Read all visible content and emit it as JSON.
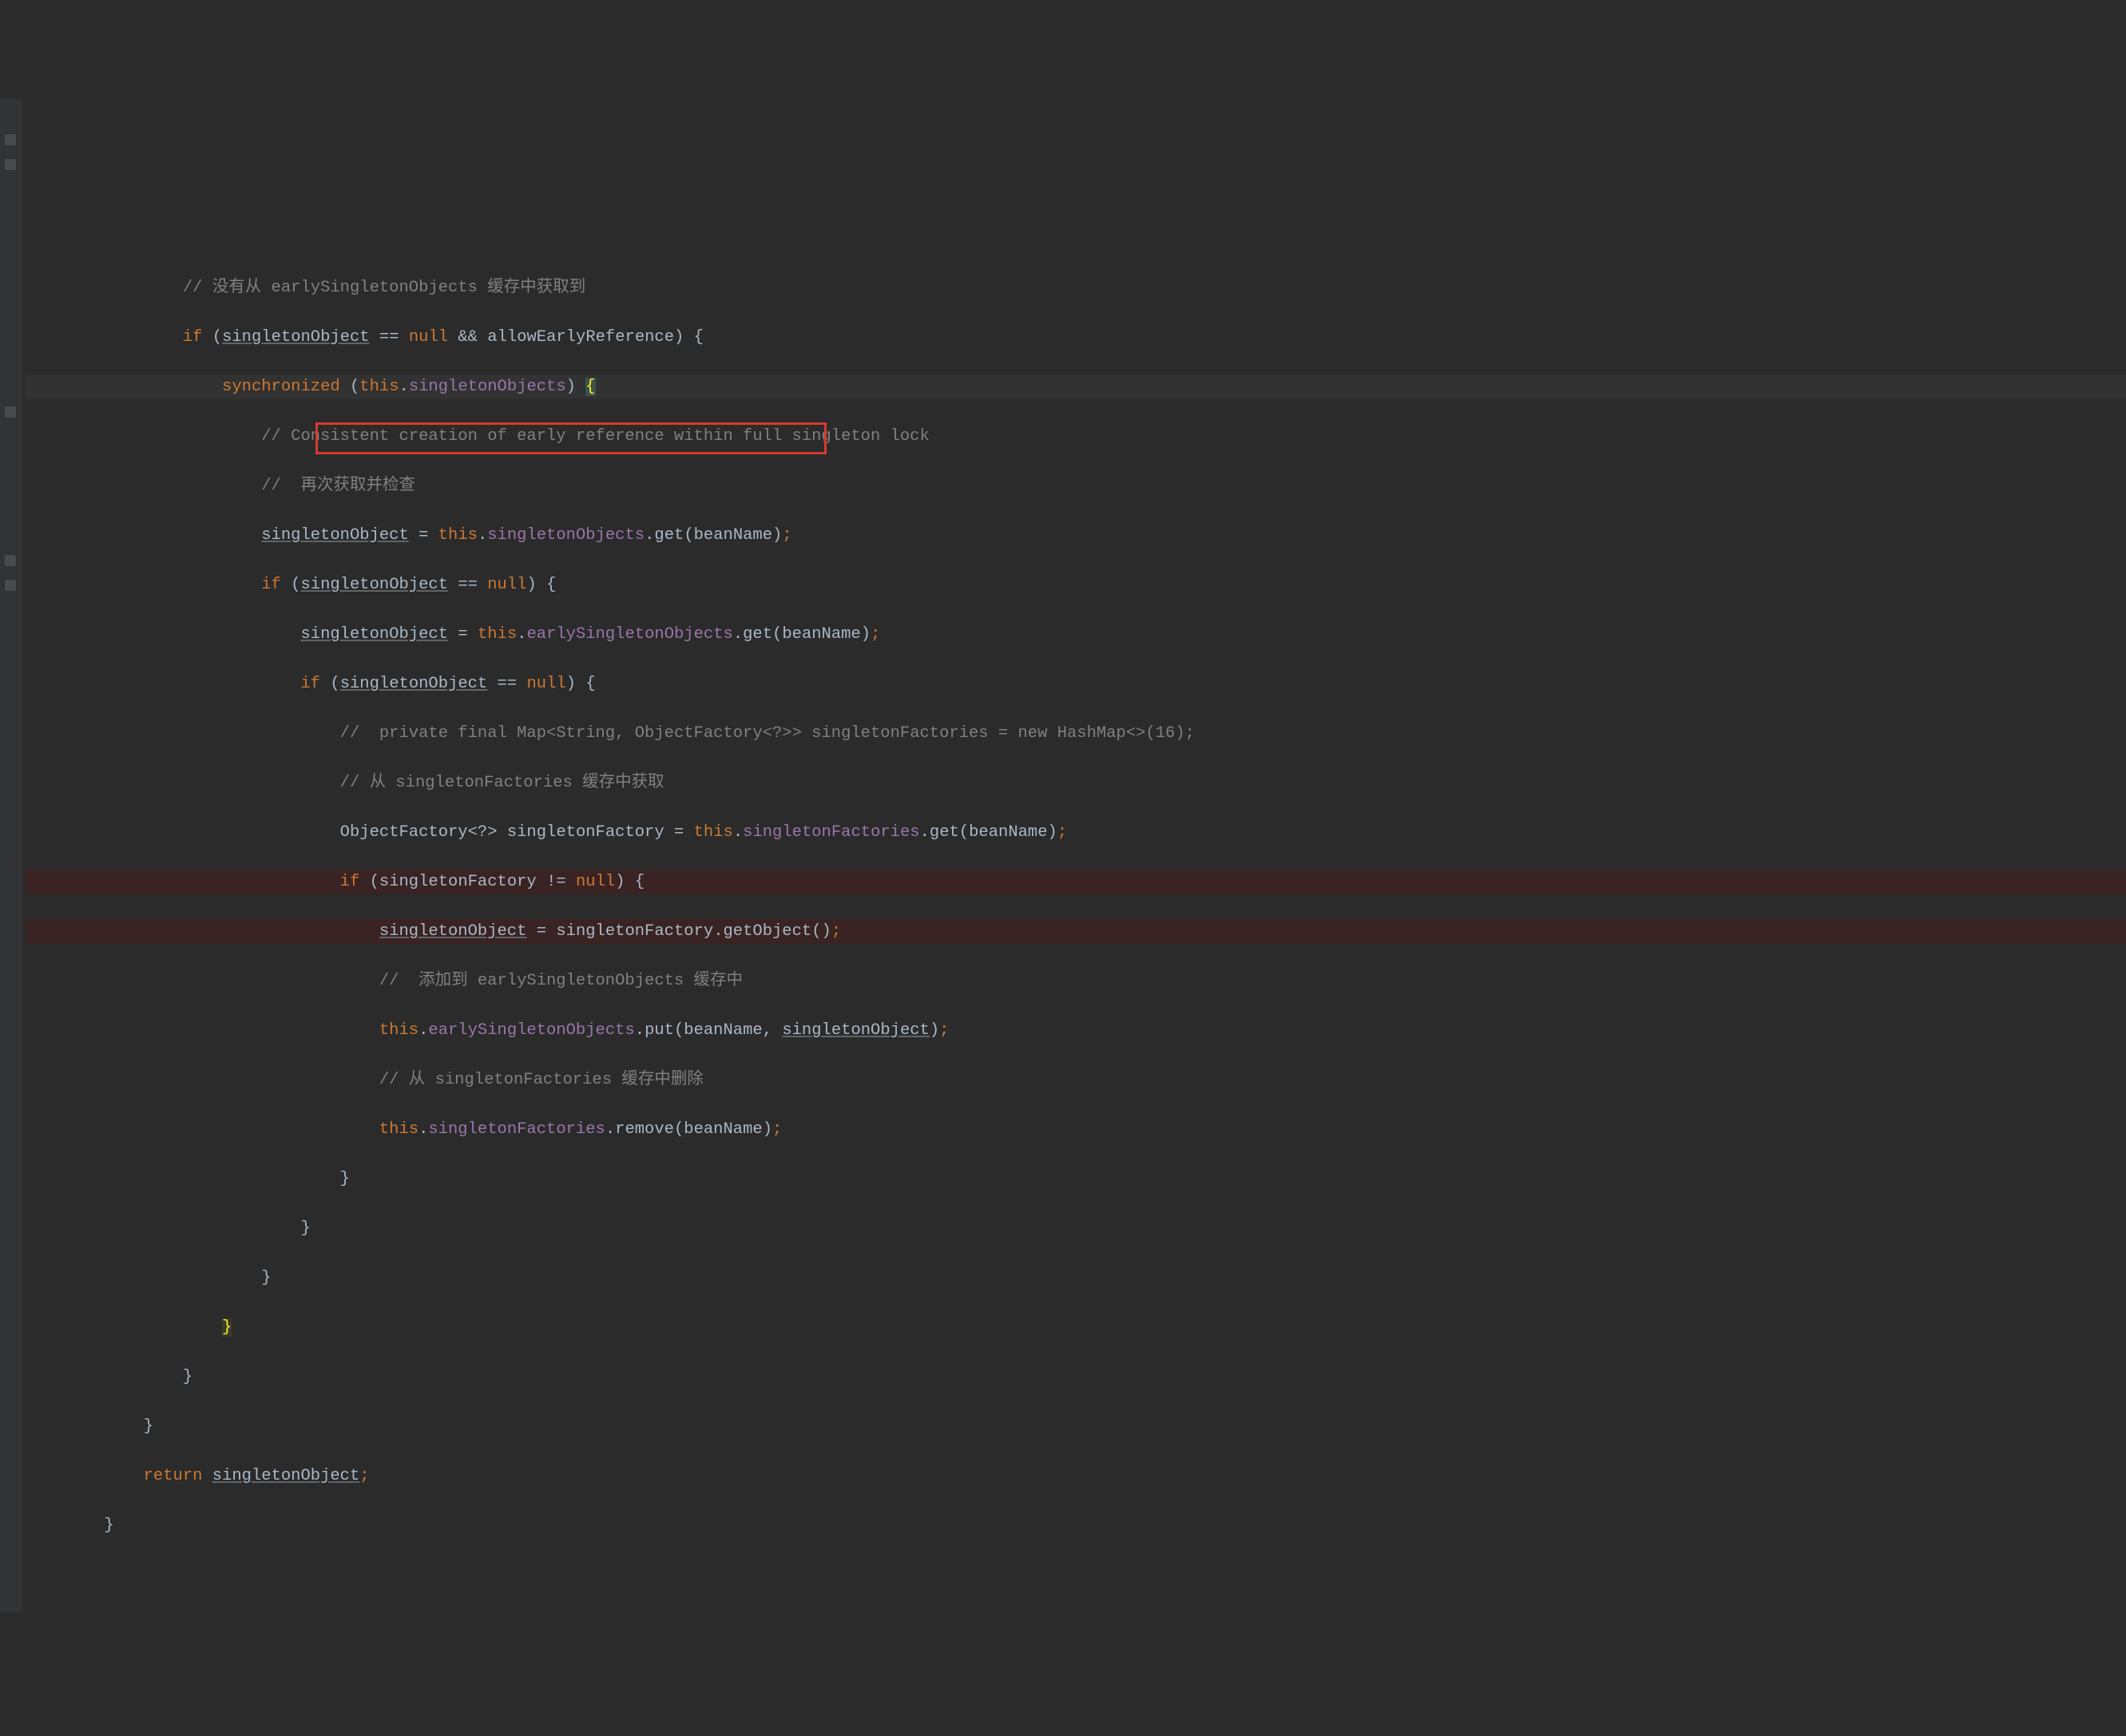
{
  "colors": {
    "background": "#2b2b2b",
    "gutter": "#313335",
    "comment": "#808080",
    "keyword": "#cc7832",
    "identifier": "#a9b7c6",
    "field": "#9876aa",
    "brace_highlight": "#ffef28",
    "debug_line_bg": "#3a2323",
    "red_box": "#d63a2f"
  },
  "tokens": {
    "kw_if": "if",
    "kw_this": "this",
    "kw_null": "null",
    "kw_synchronized": "synchronized",
    "kw_return": "return",
    "eq_eq": "==",
    "ne": "!=",
    "and_and": "&&",
    "assign": "=",
    "lparen": "(",
    "rparen": ")",
    "lbrace": "{",
    "rbrace": "}",
    "dot": ".",
    "comma": ",",
    "semi": ";"
  },
  "ident": {
    "singletonObject": "singletonObject",
    "allowEarlyReference": "allowEarlyReference",
    "singletonObjects": "singletonObjects",
    "earlySingletonObjects": "earlySingletonObjects",
    "singletonFactories": "singletonFactories",
    "singletonFactory": "singletonFactory",
    "beanName": "beanName",
    "ObjectFactory_q": "ObjectFactory<?>"
  },
  "call": {
    "get": "get",
    "getObject": "getObject",
    "put": "put",
    "remove": "remove"
  },
  "comments": {
    "c1": "// 没有从 earlySingletonObjects 缓存中获取到",
    "c2": "// Consistent creation of early reference within full singleton lock",
    "c3": "//  再次获取并检查",
    "c4": "//  private final Map<String, ObjectFactory<?>> singletonFactories = new HashMap<>(16);",
    "c5": "// 从 singletonFactories 缓存中获取",
    "c6": "//  添加到 earlySingletonObjects 缓存中",
    "c7": "// 从 singletonFactories 缓存中删除"
  },
  "indent": {
    "i3": "            ",
    "i4": "                ",
    "i5": "                    ",
    "i6": "                        ",
    "i7": "                            ",
    "i8": "                                ",
    "i9": "                                    "
  },
  "highlight_box": {
    "present": true,
    "around_line": "singletonObject = singletonFactory.getObject();"
  }
}
